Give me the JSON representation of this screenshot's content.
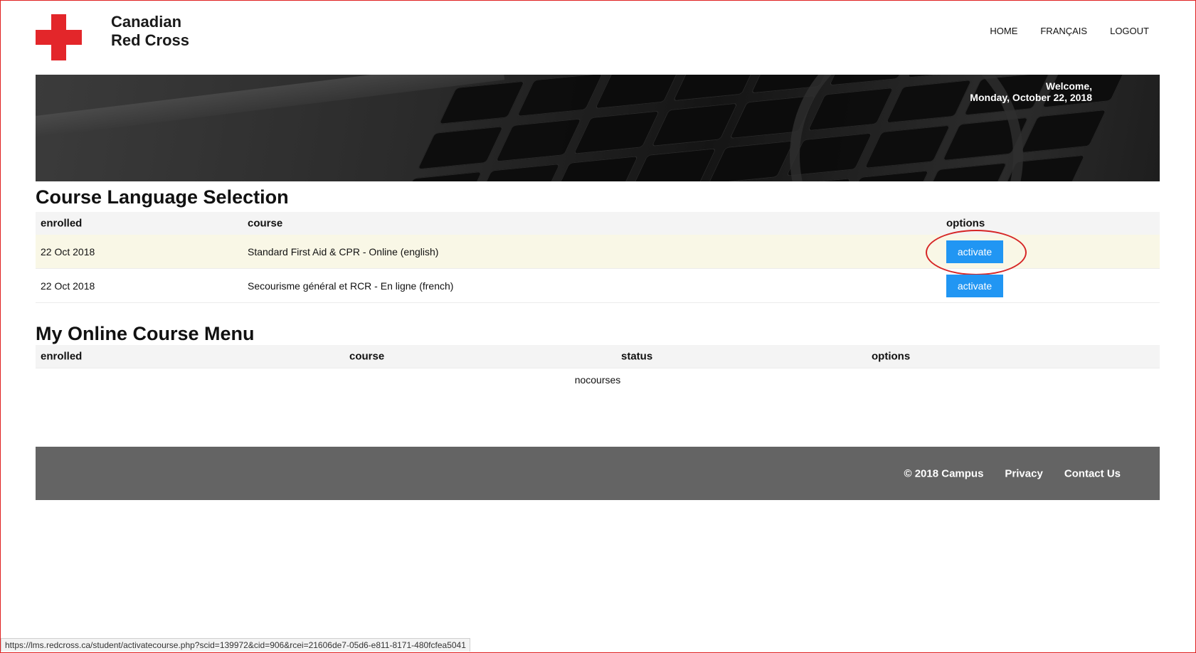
{
  "header": {
    "logo_line1": "Canadian",
    "logo_line2": "Red Cross",
    "nav": [
      "HOME",
      "FRANÇAIS",
      "LOGOUT"
    ]
  },
  "hero": {
    "welcome_line1": "Welcome,",
    "welcome_line2": "Monday, October 22, 2018"
  },
  "language_selection": {
    "title": "Course Language Selection",
    "columns": [
      "enrolled",
      "course",
      "options"
    ],
    "rows": [
      {
        "enrolled": "22 Oct 2018",
        "course": "Standard First Aid & CPR - Online (english)",
        "action": "activate"
      },
      {
        "enrolled": "22 Oct 2018",
        "course": "Secourisme général et RCR - En ligne (french)",
        "action": "activate"
      }
    ]
  },
  "course_menu": {
    "title": "My Online Course Menu",
    "columns": [
      "enrolled",
      "course",
      "status",
      "options"
    ],
    "empty_text": "nocourses"
  },
  "footer": {
    "copyright": "© 2018 Campus",
    "privacy": "Privacy",
    "contact": "Contact Us"
  },
  "statusbar": {
    "url": "https://lms.redcross.ca/student/activatecourse.php?scid=139972&cid=906&rcei=21606de7-05d6-e811-8171-480fcfea5041"
  },
  "colors": {
    "brand_red": "#e3262a",
    "button_blue": "#2196f3",
    "footer_gray": "#646464",
    "highlight_row": "#f9f7e6",
    "annotation_red": "#d62626"
  }
}
